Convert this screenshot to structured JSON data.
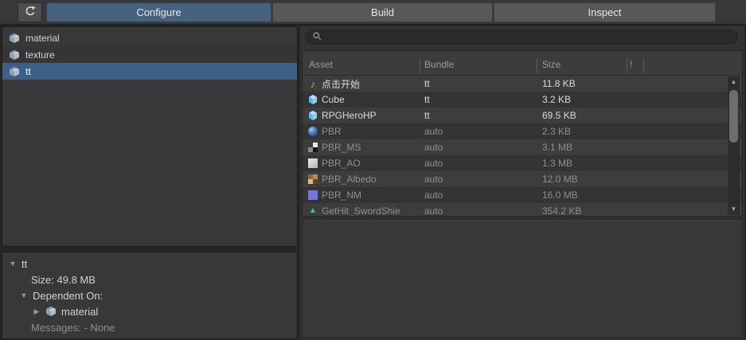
{
  "toolbar": {
    "tabs": [
      {
        "label": "Configure",
        "active": true
      },
      {
        "label": "Build",
        "active": false
      },
      {
        "label": "Inspect",
        "active": false
      }
    ]
  },
  "bundle_list": {
    "items": [
      {
        "label": "material",
        "selected": false
      },
      {
        "label": "texture",
        "selected": false
      },
      {
        "label": "tt",
        "selected": true
      }
    ]
  },
  "search": {
    "value": "",
    "placeholder": ""
  },
  "table": {
    "columns": [
      "Asset",
      "Bundle",
      "Size",
      "!"
    ],
    "rows": [
      {
        "name": "点击开始",
        "bundle": "tt",
        "size": "11.8 KB",
        "icon": "audio-clip"
      },
      {
        "name": "Cube",
        "bundle": "tt",
        "size": "3.2 KB",
        "icon": "prefab"
      },
      {
        "name": "RPGHeroHP",
        "bundle": "tt",
        "size": "69.5 KB",
        "icon": "prefab"
      },
      {
        "name": "PBR",
        "bundle": "auto",
        "size": "2.3 KB",
        "icon": "material-sphere"
      },
      {
        "name": "PBR_MS",
        "bundle": "auto",
        "size": "3.1 MB",
        "icon": "texture"
      },
      {
        "name": "PBR_AO",
        "bundle": "auto",
        "size": "1.3 MB",
        "icon": "texture"
      },
      {
        "name": "PBR_Albedo",
        "bundle": "auto",
        "size": "12.0 MB",
        "icon": "texture"
      },
      {
        "name": "PBR_NM",
        "bundle": "auto",
        "size": "16.0 MB",
        "icon": "texture"
      },
      {
        "name": "GetHit_SwordShie",
        "bundle": "auto",
        "size": "354.2 KB",
        "icon": "animation-clip"
      }
    ]
  },
  "details": {
    "title": "tt",
    "size_line": "Size: 49.8 MB",
    "dependent_label": "Dependent On:",
    "dependency": "material",
    "messages_line": "Messages: - None"
  },
  "icons": {
    "foldout_open": "▼",
    "foldout_closed": "▶",
    "scroll_up": "▲",
    "scroll_down": "▼",
    "audio_note": "♪",
    "animation_marker": "▲"
  },
  "colors": {
    "tab_active": "#46627f",
    "row_selection": "#3e5f87",
    "panel_bg": "#383838",
    "active_text": "#dadada",
    "dim_text": "#8f8f8f"
  }
}
